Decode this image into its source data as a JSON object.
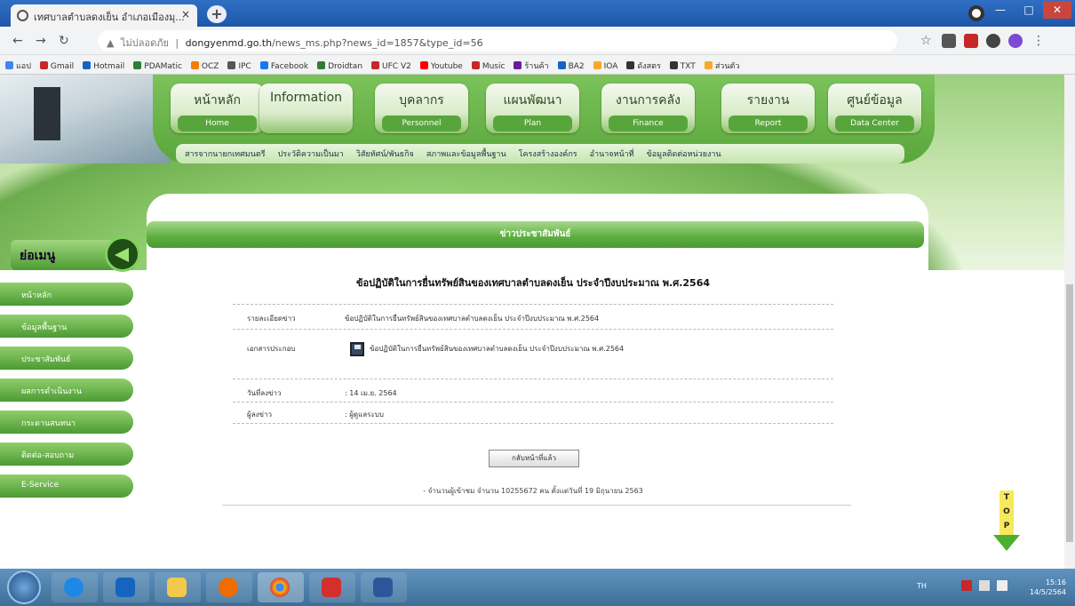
{
  "browser": {
    "tab_title": "เทศบาลตำบลดงเย็น อำเภอเมืองมุ...",
    "tab_close": "×",
    "new_tab": "+",
    "url_warning": "ไม่ปลอดภัย",
    "url_host": "dongyenmd.go.th",
    "url_path": "/news_ms.php?news_id=1857&type_id=56",
    "bookmarks": [
      "แอป",
      "Gmail",
      "Hotmail",
      "PDAMatic",
      "OCZ",
      "IPC",
      "Facebook",
      "Droidtan",
      "UFC V2",
      "Youtube",
      "Music",
      "ร้านค้า",
      "BA2",
      "IOA",
      "ดังสตร",
      "TXT",
      "ส่วนตัว"
    ]
  },
  "site": {
    "menus": [
      {
        "title": "หน้าหลัก",
        "sub": "Home"
      },
      {
        "title": "Information",
        "sub": ""
      },
      {
        "title": "บุคลากร",
        "sub": "Personnel"
      },
      {
        "title": "แผนพัฒนา",
        "sub": "Plan"
      },
      {
        "title": "งานการคลัง",
        "sub": "Finance"
      },
      {
        "title": "รายงาน",
        "sub": "Report"
      },
      {
        "title": "ศูนย์ข้อมูล",
        "sub": "Data Center"
      }
    ],
    "submenu": [
      "สารจากนายกเทศมนตรี",
      "ประวัติความเป็นมา",
      "วิสัยทัศน์/พันธกิจ",
      "สภาพและข้อมูลพื้นฐาน",
      "โครงสร้างองค์กร",
      "อำนาจหน้าที่",
      "ข้อมูลติดต่อหน่วยงาน"
    ],
    "side_header": "ย่อเมนู",
    "side_items": [
      "หน้าหลัก",
      "ข้อมูลพื้นฐาน",
      "ประชาสัมพันธ์",
      "ผลการดำเนินงาน",
      "กระดานสนทนา",
      "ติดต่อ-สอบถาม",
      "E-Service"
    ],
    "banner": "ข่าวประชาสัมพันธ์",
    "article_title": "ข้อปฏิบัติในการยื่นทรัพย์สินของเทศบาลตำบลดงเย็น ประจำปีงบประมาณ พ.ศ.2564",
    "fields": [
      {
        "label": "รายละเอียดข่าว",
        "value": "ข้อปฏิบัติในการยื่นทรัพย์สินของเทศบาลตำบลดงเย็น ประจำปีงบประมาณ พ.ศ.2564"
      },
      {
        "label": "เอกสารประกอบ",
        "value": "ข้อปฏิบัติในการยื่นทรัพย์สินของเทศบาลตำบลดงเย็น ประจำปีงบประมาณ พ.ศ.2564"
      },
      {
        "label": "วันที่ลงข่าว",
        "value": ": 14 เม.ย. 2564"
      },
      {
        "label": "ผู้ลงข่าว",
        "value": ": ผู้ดูแลระบบ"
      }
    ],
    "back_button": "กลับหน้าที่แล้ว",
    "visitors": "- จำนวนผู้เข้าชม จำนวน 10255672 คน ตั้งแต่วันที่ 19 มิถุนายน 2563",
    "top_letters": "TOP"
  },
  "taskbar": {
    "tray_lang": "TH",
    "time": "15:16",
    "date": "14/5/2564"
  }
}
